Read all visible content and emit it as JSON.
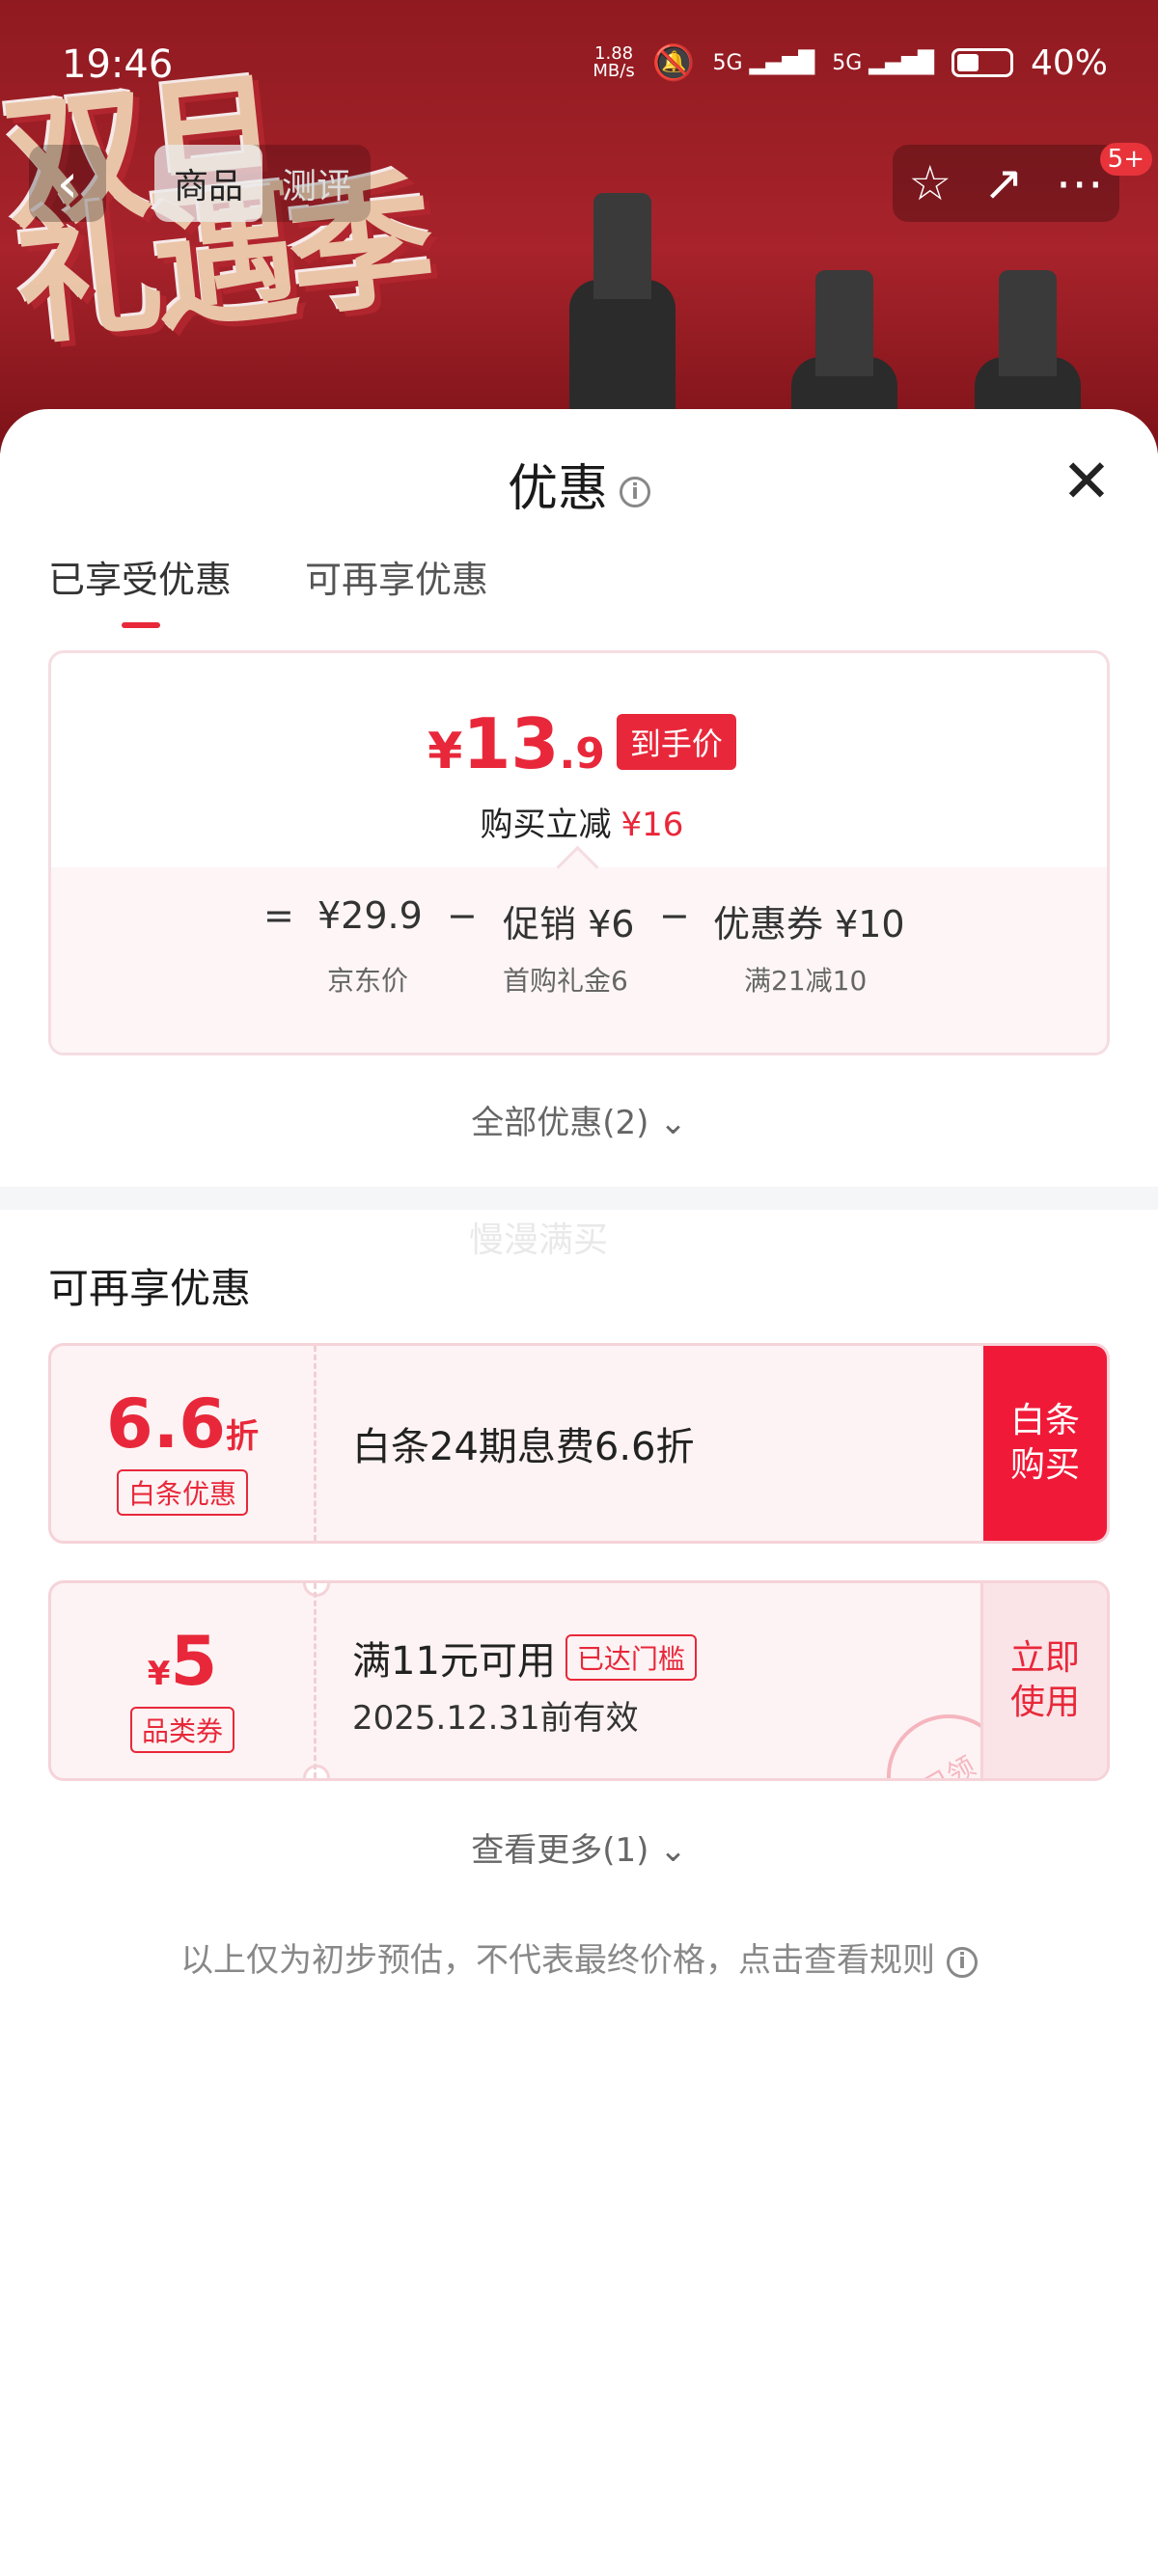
{
  "status_bar": {
    "time": "19:46",
    "net_speed": "1.88",
    "net_unit": "MB/s",
    "signal1": "5G",
    "signal2": "5G",
    "battery": "40%"
  },
  "background": {
    "promo_text": "双旦\n礼遇季"
  },
  "nav": {
    "back_icon": "chevron-left",
    "tabs": [
      "商品",
      "测评"
    ],
    "badge": "5+"
  },
  "sheet": {
    "title": "优惠",
    "tabs": [
      "已享受优惠",
      "可再享优惠"
    ],
    "summary": {
      "currency": "¥",
      "price_int": "13",
      "price_dec": ".9",
      "price_tag": "到手价",
      "reduce_label": "购买立减",
      "reduce_amount": "¥16",
      "breakdown": {
        "eq": "=",
        "base": "¥29.9",
        "base_label": "京东价",
        "minus1": "−",
        "promo": "促销 ¥6",
        "promo_label": "首购礼金6",
        "minus2": "−",
        "coupon": "优惠券 ¥10",
        "coupon_label": "满21减10"
      }
    },
    "all_offers": "全部优惠(2)",
    "watermark": "慢漫满买",
    "section_title": "可再享优惠",
    "cards": [
      {
        "value": "6.6",
        "unit": "折",
        "tag": "白条优惠",
        "title": "白条24期息费6.6折",
        "action": "白条\n购买"
      },
      {
        "currency": "¥",
        "value": "5",
        "tag": "品类券",
        "title": "满11元可用",
        "reached": "已达门槛",
        "expiry": "2025.12.31前有效",
        "action": "立即\n使用",
        "stamp": "已领"
      }
    ],
    "see_more": "查看更多(1)",
    "disclaimer": "以上仅为初步预估，不代表最终价格，点击查看规则"
  },
  "colors": {
    "accent": "#e8283a",
    "card_bg": "#fdf3f4",
    "solid_action": "#f01a38"
  }
}
